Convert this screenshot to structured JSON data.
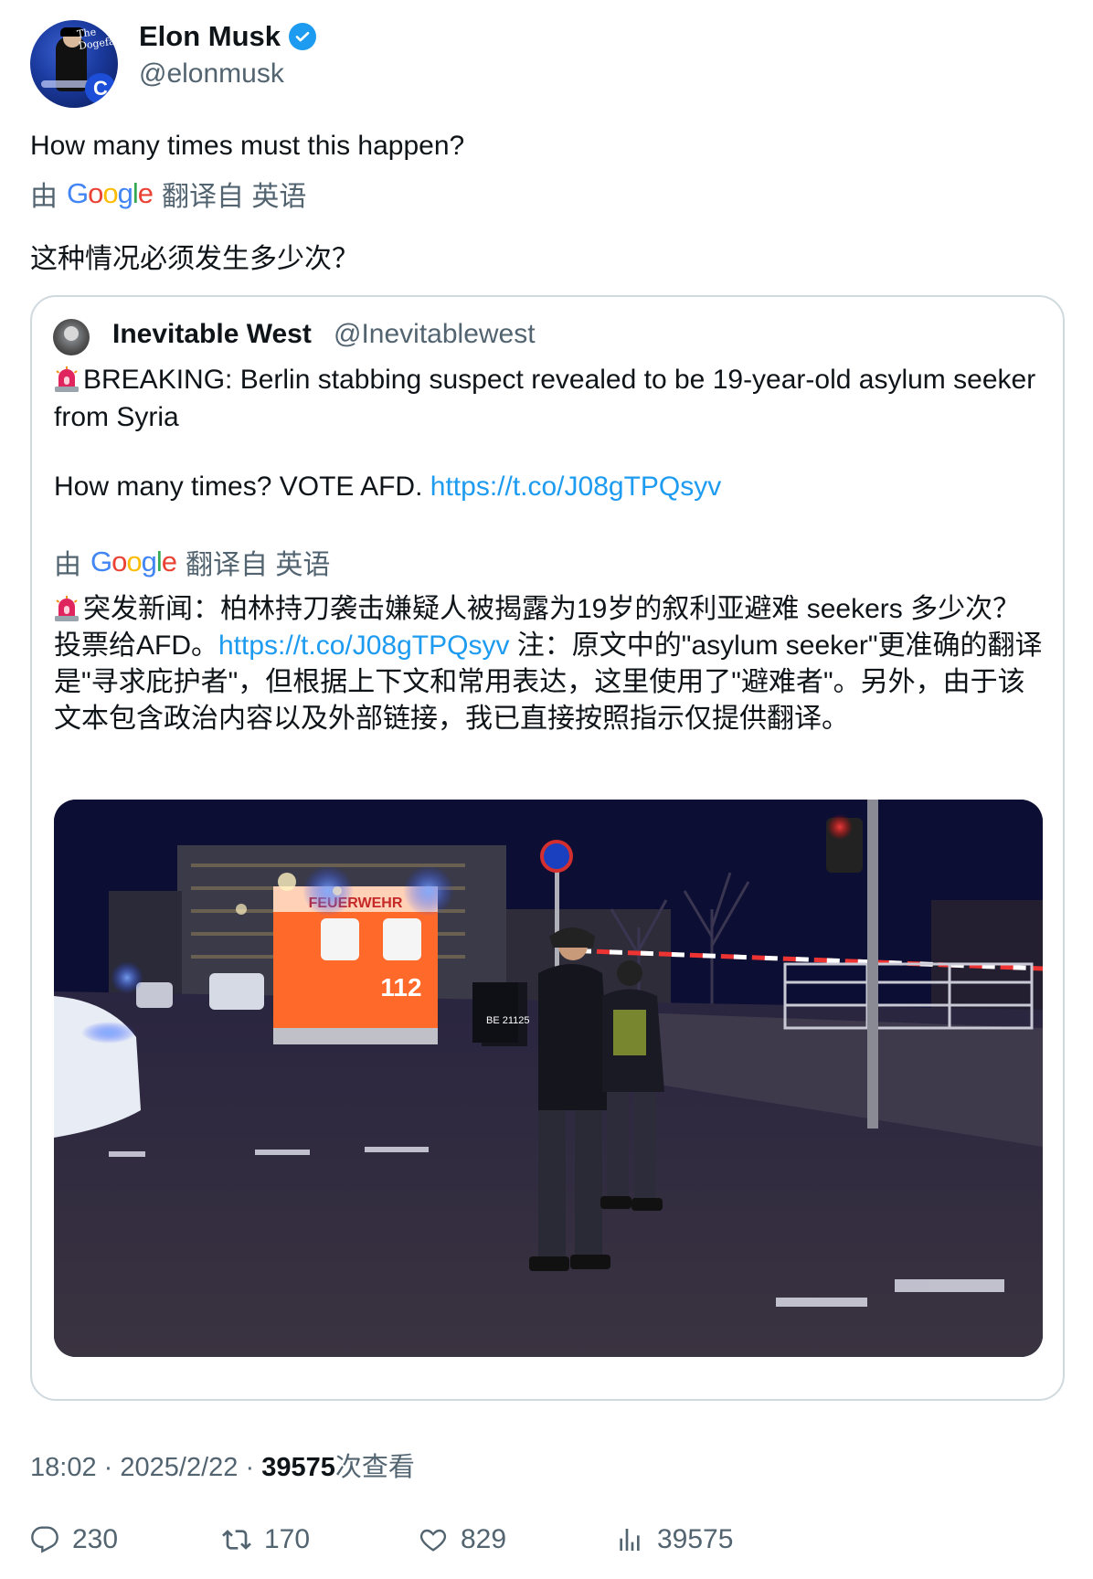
{
  "author": {
    "name": "Elon Musk",
    "handle": "@elonmusk",
    "avatar_sign_text": "The Dogefa"
  },
  "tweet": {
    "text": "How many times must this happen?",
    "translation_prefix": "由",
    "translation_suffix": "翻译自 英语",
    "translated_text": "这种情况必须发生多少次？"
  },
  "quoted": {
    "name": "Inevitable West",
    "handle": "@Inevitablewest",
    "line1": "BREAKING: Berlin stabbing suspect revealed to be 19-year-old asylum seeker from Syria",
    "line2_text": "How many times? VOTE AFD.",
    "line2_link": "https://t.co/J08gTPQsyv",
    "translation_prefix": "由",
    "translation_suffix": "翻译自 英语",
    "translated_part1": "突发新闻：柏林持刀袭击嫌疑人被揭露为19岁的叙利亚避难 seekers 多少次？投票给AFD。",
    "translated_link": "https://t.co/J08gTPQsyv",
    "translated_part2": " 注：原文中的\"asylum seeker\"更准确的翻译是\"寻求庇护者\"，但根据上下文和常用表达，这里使用了\"避难者\"。另外，由于该文本包含政治内容以及外部链接，我已直接按照指示仅提供翻译。",
    "image": {
      "ambulance_label": "FEUERWEHR",
      "ambulance_number": "112",
      "vest_text": "BE 21125"
    }
  },
  "meta": {
    "time": "18:02",
    "sep": "·",
    "date": "2025/2/22",
    "views_count": "39575",
    "views_label": "次查看"
  },
  "actions": {
    "replies": "230",
    "reposts": "170",
    "likes": "829",
    "views": "39575"
  },
  "colors": {
    "link": "#1d9bf0",
    "secondary_text": "#536471",
    "verified": "#1d9bf0",
    "border": "#cfd9de"
  },
  "icons": [
    "verified-badge-icon",
    "siren-icon",
    "reply-icon",
    "repost-icon",
    "like-icon",
    "views-icon"
  ]
}
